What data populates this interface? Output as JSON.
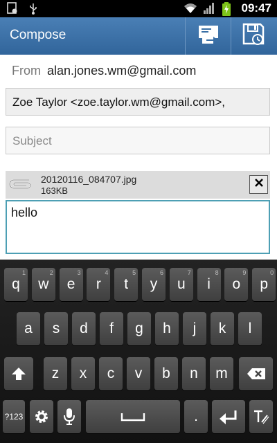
{
  "status_bar": {
    "time": "09:47",
    "icons": [
      "screenshot-icon",
      "usb-icon",
      "wifi-icon",
      "signal-icon",
      "battery-charging-icon"
    ]
  },
  "action_bar": {
    "title": "Compose",
    "actions": [
      "send-icon",
      "save-draft-icon"
    ]
  },
  "compose": {
    "from_label": "From",
    "from_value": "alan.jones.wm@gmail.com",
    "to_value": "Zoe Taylor <zoe.taylor.wm@gmail.com>,",
    "subject_placeholder": "Subject",
    "attachment": {
      "name": "20120116_084707.jpg",
      "size": "163KB"
    },
    "body": "hello"
  },
  "keyboard": {
    "row1": [
      {
        "label": "q",
        "hint": "1"
      },
      {
        "label": "w",
        "hint": "2"
      },
      {
        "label": "e",
        "hint": "3"
      },
      {
        "label": "r",
        "hint": "4"
      },
      {
        "label": "t",
        "hint": "5"
      },
      {
        "label": "y",
        "hint": "6"
      },
      {
        "label": "u",
        "hint": "7"
      },
      {
        "label": "i",
        "hint": "8"
      },
      {
        "label": "o",
        "hint": "9"
      },
      {
        "label": "p",
        "hint": "0"
      }
    ],
    "row2": [
      "a",
      "s",
      "d",
      "f",
      "g",
      "h",
      "j",
      "k",
      "l"
    ],
    "row3": [
      "z",
      "x",
      "c",
      "v",
      "b",
      "n",
      "m"
    ],
    "symbols_label": "?123",
    "period_label": "."
  },
  "colors": {
    "action_bar": "#3a6fa5",
    "focus_border": "#4d9fb4",
    "battery": "#7ec41a"
  }
}
